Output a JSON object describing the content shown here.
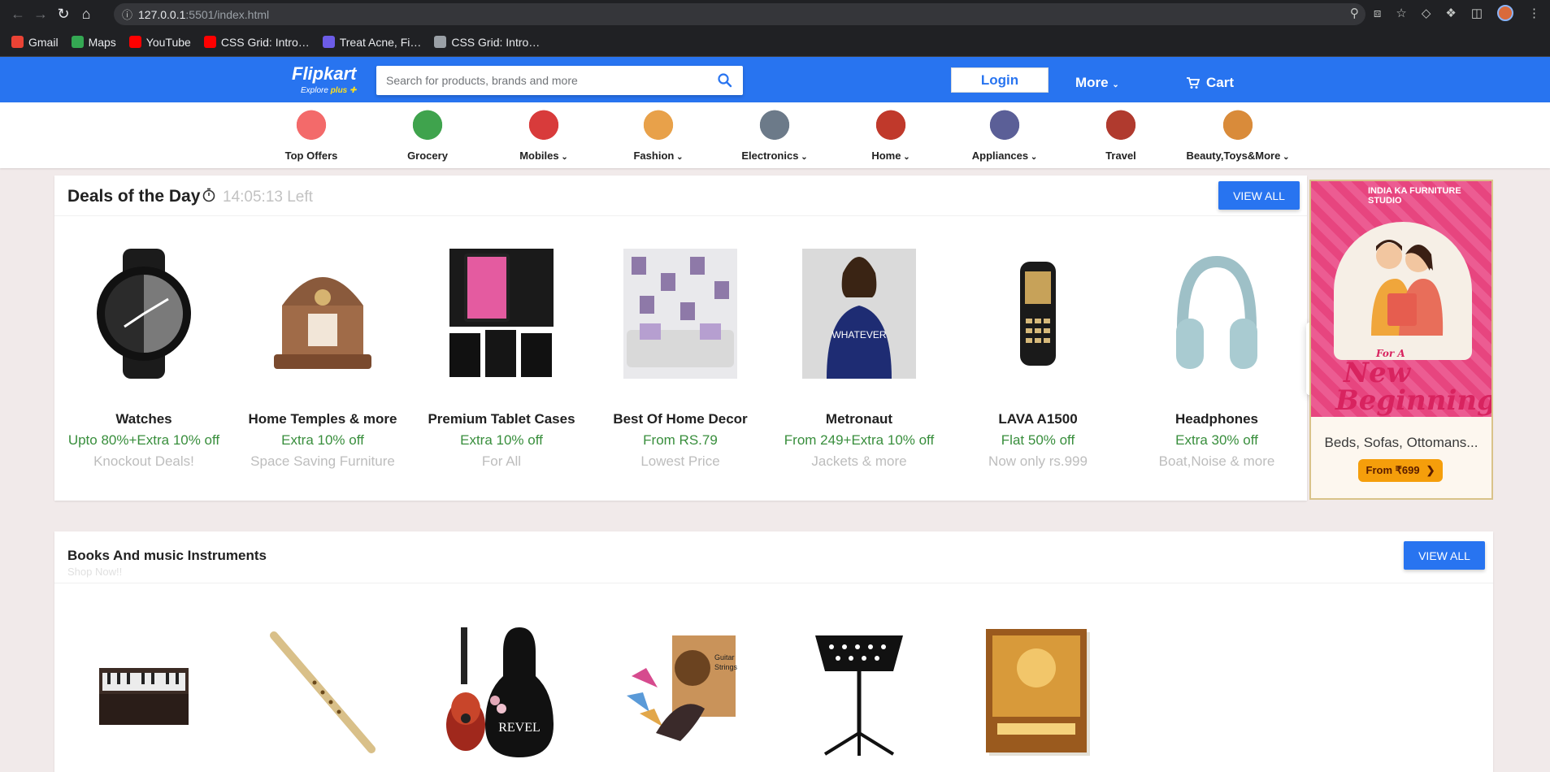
{
  "browser": {
    "url_host": "127.0.0.1",
    "url_path": ":5501/index.html",
    "bookmarks": [
      {
        "label": "Gmail",
        "icon": "gmail-icon",
        "color": "#ea4335"
      },
      {
        "label": "Maps",
        "icon": "maps-icon",
        "color": "#34a853"
      },
      {
        "label": "YouTube",
        "icon": "youtube-icon",
        "color": "#ff0000"
      },
      {
        "label": "CSS Grid: Intro…",
        "icon": "youtube-icon",
        "color": "#ff0000"
      },
      {
        "label": "Treat Acne, Fi…",
        "icon": "site-icon",
        "color": "#6c5ce7"
      },
      {
        "label": "CSS Grid: Intro…",
        "icon": "globe-icon",
        "color": "#9aa0a6"
      }
    ]
  },
  "header": {
    "logo": "Flipkart",
    "logo_sub": "Explore",
    "logo_plus": "plus",
    "search_placeholder": "Search for products, brands and more",
    "login": "Login",
    "more": "More",
    "cart": "Cart",
    "brand_color": "#2874f0"
  },
  "categories": [
    {
      "label": "Top Offers",
      "icon": "top-offers-icon",
      "has_menu": false
    },
    {
      "label": "Grocery",
      "icon": "grocery-icon",
      "has_menu": false
    },
    {
      "label": "Mobiles",
      "icon": "mobiles-icon",
      "has_menu": true
    },
    {
      "label": "Fashion",
      "icon": "fashion-icon",
      "has_menu": true
    },
    {
      "label": "Electronics",
      "icon": "electronics-icon",
      "has_menu": true
    },
    {
      "label": "Home",
      "icon": "home-icon",
      "has_menu": true
    },
    {
      "label": "Appliances",
      "icon": "appliances-icon",
      "has_menu": true
    },
    {
      "label": "Travel",
      "icon": "travel-icon",
      "has_menu": false
    },
    {
      "label": "Beauty,Toys&More",
      "icon": "beauty-toys-icon",
      "has_menu": true
    }
  ],
  "deals": {
    "title": "Deals of the Day",
    "timer": "14:05:13 Left",
    "view_all": "VIEW ALL",
    "items": [
      {
        "name": "Watches",
        "offer": "Upto 80%+Extra 10% off",
        "sub": "Knockout Deals!",
        "icon": "watch-image"
      },
      {
        "name": "Home Temples & more",
        "offer": "Extra 10% off",
        "sub": "Space Saving Furniture",
        "icon": "temple-image"
      },
      {
        "name": "Premium Tablet Cases",
        "offer": "Extra 10% off",
        "sub": "For All",
        "icon": "tablet-case-image"
      },
      {
        "name": "Best Of Home Decor",
        "offer": "From RS.79",
        "sub": "Lowest Price",
        "icon": "home-decor-image"
      },
      {
        "name": "Metronaut",
        "offer": "From 249+Extra 10% off",
        "sub": "Jackets & more",
        "icon": "jacket-image"
      },
      {
        "name": "LAVA A1500",
        "offer": "Flat 50% off",
        "sub": "Now only rs.999",
        "icon": "phone-image"
      },
      {
        "name": "Headphones",
        "offer": "Extra 30% off",
        "sub": "Boat,Noise & more",
        "icon": "headphones-image"
      }
    ]
  },
  "ad": {
    "brand": "INDIA KA FURNITURE STUDIO",
    "script_line1": "For A",
    "script_line2": "New",
    "script_line3": "Beginning",
    "caption": "Beds, Sofas, Ottomans...",
    "button": "From ₹699"
  },
  "books": {
    "title": "Books And music Instruments",
    "subtitle": "Shop Now!!",
    "view_all": "VIEW ALL",
    "items": [
      {
        "icon": "harmonium-image"
      },
      {
        "icon": "flute-image"
      },
      {
        "icon": "guitar-image"
      },
      {
        "icon": "guitar-strings-image"
      },
      {
        "icon": "music-stand-image"
      },
      {
        "icon": "bhagavad-gita-book-image"
      }
    ]
  }
}
